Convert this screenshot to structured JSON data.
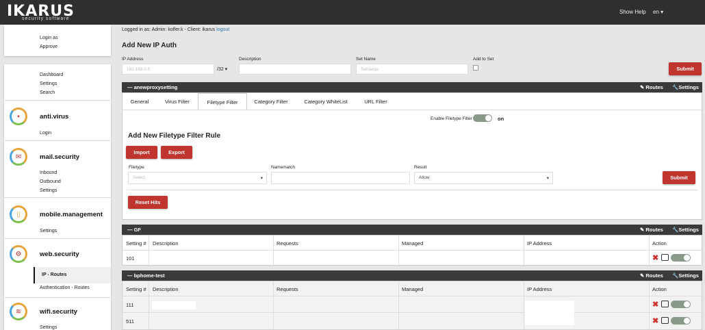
{
  "topbar": {
    "logo": "IKARUS",
    "logo_sub": "security software",
    "show_help": "Show Help",
    "lang": "en ▾"
  },
  "sidebar": {
    "top": [
      "Login as",
      "Approve"
    ],
    "general": [
      "Dashboard",
      "Settings",
      "Search"
    ],
    "products": [
      {
        "name": "anti.virus",
        "items": [
          "Login"
        ]
      },
      {
        "name": "mail.security",
        "items": [
          "Inbound",
          "Outbound",
          "Settings"
        ]
      },
      {
        "name": "mobile.management",
        "items": [
          "Settings"
        ]
      },
      {
        "name": "web.security",
        "items": [
          "IP - Routes",
          "Authentication - Routes"
        ]
      },
      {
        "name": "wifi.security",
        "items": [
          "Settings"
        ]
      }
    ]
  },
  "login_info": {
    "text": "Logged in as: Admin: kofler.k - Client: ikarus",
    "logout": "logout"
  },
  "add_ip": {
    "title": "Add New IP Auth",
    "ip_label": "IP Address",
    "ip_placeholder": "192.168.0.0",
    "mask": "/32 ▾",
    "desc_label": "Description",
    "setname_label": "Set Name",
    "setname_placeholder": "Setname",
    "addset_label": "Add to Set",
    "submit": "Submit"
  },
  "proxy_panel": {
    "title": "anewproxysetting",
    "routes": "Routes",
    "settings": "Settings",
    "tabs": [
      "General",
      "Virus Filter",
      "Filetype Filter",
      "Category Filter",
      "Category WhiteList",
      "URL Filter"
    ],
    "enable_label": "Enable Filetype Filter",
    "enable_state": "on",
    "rule_title": "Add New Filetype Filter Rule",
    "import": "Import",
    "export": "Export",
    "filetype_label": "Filetype",
    "filetype_placeholder": "Select",
    "namematch_label": "Namematch",
    "result_label": "Result",
    "result_value": "Allow",
    "submit": "Submit",
    "reset": "Reset Hits"
  },
  "table_headers": [
    "Setting #",
    "Description",
    "Requests",
    "Managed",
    "IP Address",
    "Action"
  ],
  "gf_panel": {
    "title": "GF",
    "routes": "Routes",
    "settings": "Settings",
    "rows": [
      {
        "setting": "101"
      }
    ]
  },
  "bp_panel": {
    "title": "bphome-test",
    "routes": "Routes",
    "settings": "Settings",
    "rows": [
      {
        "setting": "111"
      },
      {
        "setting": "511"
      }
    ]
  }
}
